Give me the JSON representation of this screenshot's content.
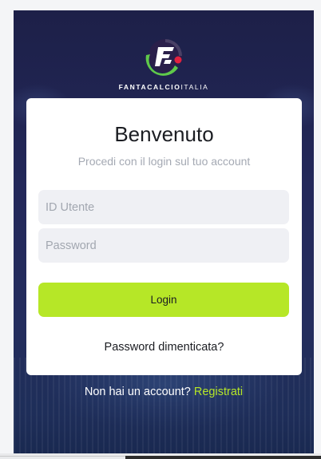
{
  "brand": {
    "logo_alt": "FantacalcioItalia logo",
    "name_bold": "FANTACALCIO",
    "name_light": "ITALIA"
  },
  "login_card": {
    "title": "Benvenuto",
    "subtitle": "Procedi con il login sul tuo account",
    "username_placeholder": "ID Utente",
    "username_value": "",
    "password_placeholder": "Password",
    "password_value": "",
    "login_label": "Login",
    "forgot_label": "Password dimenticata?"
  },
  "signup": {
    "prompt": "Non hai un account?",
    "link_label": "Registrati"
  },
  "colors": {
    "accent": "#b6e727",
    "background": "#23285a",
    "card": "#ffffff",
    "input_bg": "#eff0f4"
  }
}
